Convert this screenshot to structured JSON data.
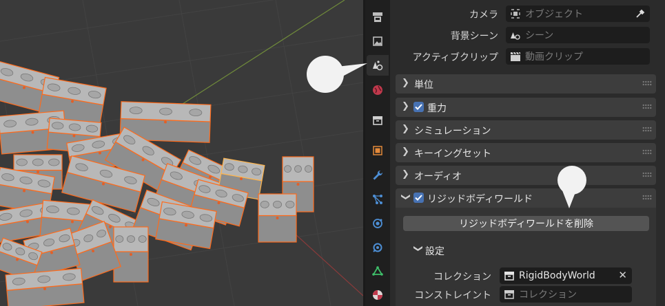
{
  "scene_props": {
    "camera": {
      "label": "カメラ",
      "placeholder": "オブジェクト"
    },
    "background_scene": {
      "label": "背景シーン",
      "placeholder": "シーン"
    },
    "active_clip": {
      "label": "アクティブクリップ",
      "placeholder": "動画クリップ"
    }
  },
  "panels": [
    {
      "title": "単位",
      "checkbox": false,
      "expanded": false
    },
    {
      "title": "重力",
      "checkbox": true,
      "expanded": false
    },
    {
      "title": "シミュレーション",
      "checkbox": false,
      "expanded": false
    },
    {
      "title": "キーイングセット",
      "checkbox": false,
      "expanded": false
    },
    {
      "title": "オーディオ",
      "checkbox": false,
      "expanded": false
    },
    {
      "title": "リジッドボディワールド",
      "checkbox": true,
      "expanded": true
    }
  ],
  "rigid_body_world": {
    "remove_button": "リジッドボディワールドを削除",
    "settings_title": "設定",
    "collection": {
      "label": "コレクション",
      "value": "RigidBodyWorld"
    },
    "constraints": {
      "label": "コンストレイント",
      "placeholder": "コレクション"
    }
  },
  "tabs": [
    "tool-icon",
    "render-icon",
    "scene-icon",
    "world-icon",
    "collection-icon",
    "object-icon",
    "modifier-icon",
    "particles-icon",
    "physics-icon",
    "constraints-icon",
    "data-icon",
    "material-icon"
  ],
  "colors": {
    "accent": "#4772b3",
    "selection": "#ff6a1a",
    "active_selection": "#ffb54d"
  }
}
